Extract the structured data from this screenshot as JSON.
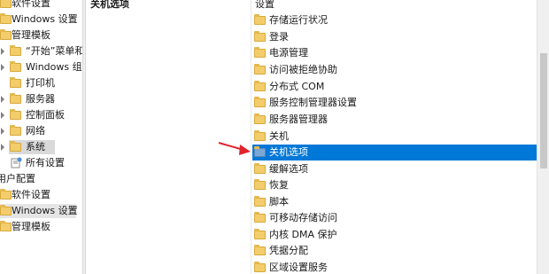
{
  "tree": {
    "items": [
      {
        "label": "软件设置",
        "indent": 1,
        "arrow": true
      },
      {
        "label": "Windows 设置",
        "indent": 1,
        "arrow": true
      },
      {
        "label": "管理模板",
        "indent": 1,
        "arrow": true
      },
      {
        "label": "“开始”菜单和",
        "indent": 2,
        "arrow": true
      },
      {
        "label": "Windows 组",
        "indent": 2,
        "arrow": true
      },
      {
        "label": "打印机",
        "indent": 2,
        "arrow": false
      },
      {
        "label": "服务器",
        "indent": 2,
        "arrow": true
      },
      {
        "label": "控制面板",
        "indent": 2,
        "arrow": true
      },
      {
        "label": "网络",
        "indent": 2,
        "arrow": true
      },
      {
        "label": "系统",
        "indent": 2,
        "arrow": true,
        "selected": true
      },
      {
        "label": "所有设置",
        "indent": 2,
        "arrow": false,
        "icon": "settings-icon"
      },
      {
        "label": "用户配置",
        "indent": 0,
        "arrow": false,
        "noicon": true
      },
      {
        "label": "软件设置",
        "indent": 1,
        "arrow": true
      },
      {
        "label": "Windows 设置",
        "indent": 1,
        "arrow": true
      },
      {
        "label": "管理模板",
        "indent": 1,
        "arrow": true
      }
    ]
  },
  "main": {
    "header_left": "关机选项",
    "header_right": "设置",
    "items": [
      {
        "label": "存储运行状况"
      },
      {
        "label": "登录"
      },
      {
        "label": "电源管理"
      },
      {
        "label": "访问被拒绝协助"
      },
      {
        "label": "分布式 COM"
      },
      {
        "label": "服务控制管理器设置"
      },
      {
        "label": "服务器管理器"
      },
      {
        "label": "关机"
      },
      {
        "label": "关机选项",
        "selected": true
      },
      {
        "label": "缓解选项"
      },
      {
        "label": "恢复"
      },
      {
        "label": "脚本"
      },
      {
        "label": "可移动存储访问"
      },
      {
        "label": "内核 DMA 保护"
      },
      {
        "label": "凭据分配"
      },
      {
        "label": "区域设置服务"
      }
    ]
  },
  "colors": {
    "selection": "#0078d7",
    "arrow": "#e0242c"
  }
}
